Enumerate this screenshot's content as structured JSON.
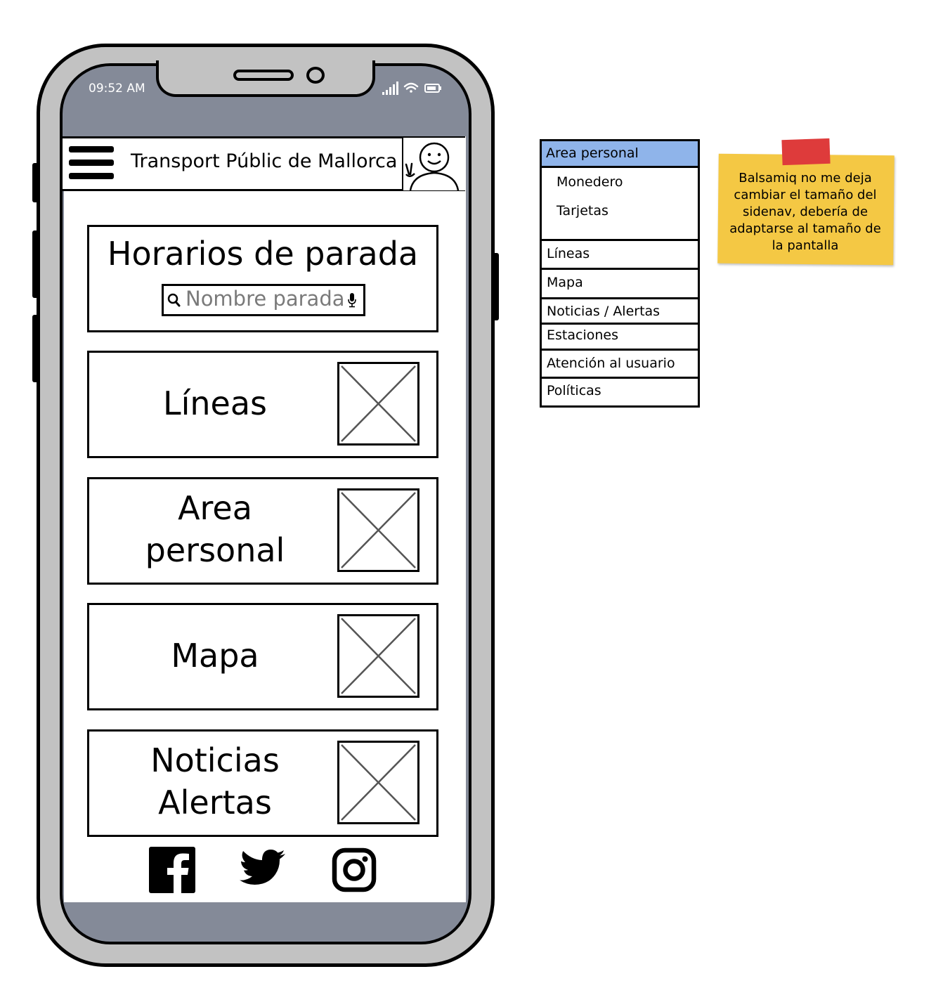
{
  "status_bar": {
    "time": "09:52 AM"
  },
  "header": {
    "title": "Transport Públic de Mallorca"
  },
  "horarios": {
    "title": "Horarios de parada",
    "search_placeholder": "Nombre parada"
  },
  "cards": {
    "lineas": "Líneas",
    "area_line1": "Area",
    "area_line2": "personal",
    "mapa": "Mapa",
    "noticias_line1": "Noticias",
    "noticias_line2": "Alertas"
  },
  "sidenav": {
    "area_personal": "Area personal",
    "monedero": "Monedero",
    "tarjetas": "Tarjetas",
    "lineas": "Líneas",
    "mapa": "Mapa",
    "noticias": "Noticias / Alertas",
    "estaciones": "Estaciones",
    "atencion": "Atención al usuario",
    "politicas": "Políticas"
  },
  "note": {
    "text": "Balsamiq no me deja cambiar el tamaño del sidenav, debería de adaptarse al tamaño de la pantalla"
  },
  "colors": {
    "screen_gray": "#848a98",
    "frame_gray": "#c2c2c2",
    "nav_highlight": "#8fb4ea",
    "sticky_yellow": "#f4c844",
    "tape_red": "#de3b3b"
  },
  "icons": {
    "menu": "hamburger-icon",
    "avatar": "avatar-icon",
    "search": "search-icon",
    "mic": "microphone-icon",
    "image": "image-placeholder-icon",
    "facebook": "facebook-icon",
    "twitter": "twitter-icon",
    "instagram": "instagram-icon"
  }
}
